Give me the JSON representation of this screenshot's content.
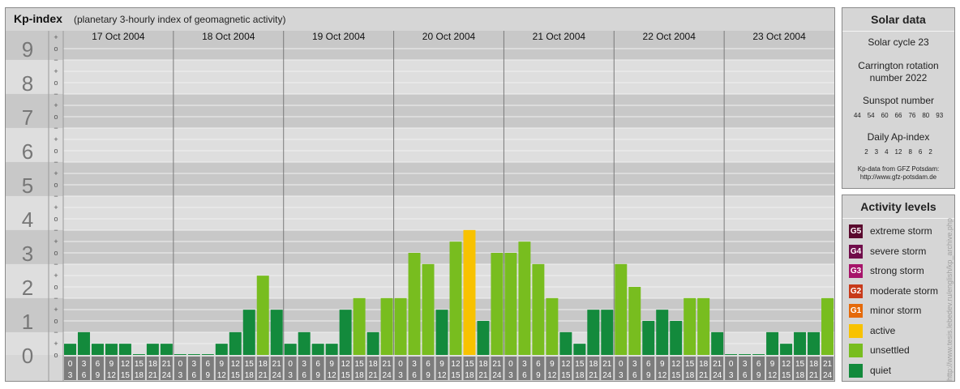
{
  "header": {
    "title": "Kp-index",
    "subtitle": "(planetary 3-hourly index of geomagnetic activity)"
  },
  "chart_data": {
    "type": "bar",
    "title": "Kp-index",
    "subtitle": "(planetary 3-hourly index of geomagnetic activity)",
    "y_major_labels": [
      "0",
      "1",
      "2",
      "3",
      "4",
      "5",
      "6",
      "7",
      "8",
      "9"
    ],
    "y_minor_labels": [
      "−",
      "o",
      "+"
    ],
    "ylim": [
      0,
      9.33
    ],
    "days": [
      "17 Oct 2004",
      "18 Oct 2004",
      "19 Oct 2004",
      "20 Oct 2004",
      "21 Oct 2004",
      "22 Oct 2004",
      "23 Oct 2004"
    ],
    "x_tick_labels": [
      [
        "0",
        "3"
      ],
      [
        "3",
        "6"
      ],
      [
        "6",
        "9"
      ],
      [
        "9",
        "12"
      ],
      [
        "12",
        "15"
      ],
      [
        "15",
        "18"
      ],
      [
        "18",
        "21"
      ],
      [
        "21",
        "24"
      ]
    ],
    "values": [
      [
        0.33,
        0.67,
        0.33,
        0.33,
        0.33,
        0,
        0.33,
        0.33
      ],
      [
        0,
        0,
        0,
        0.33,
        0.67,
        1.33,
        2.33,
        1.33
      ],
      [
        0.33,
        0.67,
        0.33,
        0.33,
        1.33,
        1.67,
        0.67,
        1.67
      ],
      [
        1.67,
        3,
        2.67,
        1.33,
        3.33,
        3.67,
        1,
        3
      ],
      [
        3,
        3.33,
        2.67,
        1.67,
        0.67,
        0.33,
        1.33,
        1.33
      ],
      [
        2.67,
        2,
        1,
        1.33,
        1,
        1.67,
        1.67,
        0.67
      ],
      [
        0,
        0,
        0,
        0.67,
        0.33,
        0.67,
        0.67,
        1.67
      ]
    ],
    "colors": {
      "quiet": "#138a3c",
      "unsettled": "#78bd1f",
      "active": "#f8c200"
    },
    "grid": true
  },
  "solar": {
    "title": "Solar data",
    "cycle": "Solar cycle 23",
    "rotation_line1": "Carrington rotation",
    "rotation_line2": "number 2022",
    "sunspot_label": "Sunspot number",
    "sunspot_values": [
      "44",
      "54",
      "60",
      "66",
      "76",
      "80",
      "93"
    ],
    "ap_label": "Daily Ap-index",
    "ap_values": [
      "2",
      "3",
      "4",
      "12",
      "8",
      "6",
      "2"
    ],
    "source_line1": "Kp-data from GFZ Potsdam:",
    "source_line2": "http://www.gfz-potsdam.de"
  },
  "levels": {
    "title": "Activity levels",
    "items": [
      {
        "code": "G5",
        "label": "extreme storm",
        "color": "#5a0a2e"
      },
      {
        "code": "G4",
        "label": "severe storm",
        "color": "#700d4a"
      },
      {
        "code": "G3",
        "label": "strong storm",
        "color": "#a6146a"
      },
      {
        "code": "G2",
        "label": "moderate storm",
        "color": "#c83a1a"
      },
      {
        "code": "G1",
        "label": "minor storm",
        "color": "#e56a0a"
      },
      {
        "code": "",
        "label": "active",
        "color": "#f8c200"
      },
      {
        "code": "",
        "label": "unsettled",
        "color": "#78bd1f"
      },
      {
        "code": "",
        "label": "quiet",
        "color": "#138a3c"
      }
    ]
  },
  "credit": "http://www.tesis.lebedev.ru/english/kp_archive.php"
}
